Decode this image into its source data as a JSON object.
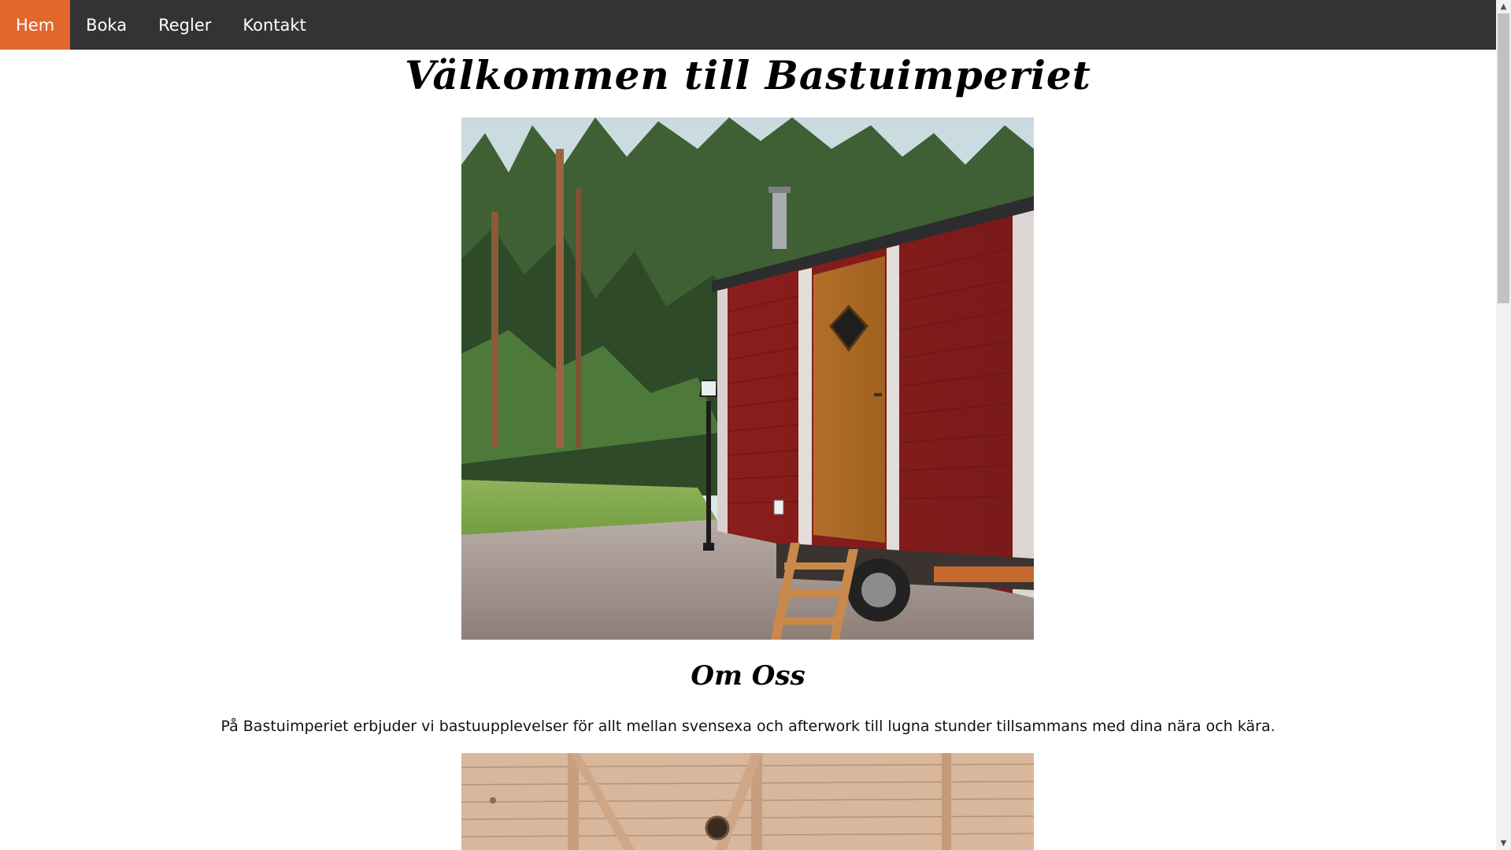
{
  "nav": {
    "items": [
      {
        "label": "Hem",
        "active": true
      },
      {
        "label": "Boka",
        "active": false
      },
      {
        "label": "Regler",
        "active": false
      },
      {
        "label": "Kontakt",
        "active": false
      }
    ]
  },
  "main": {
    "title": "Välkommen till Bastuimperiet",
    "about_heading": "Om Oss",
    "about_text": "På Bastuimperiet erbjuder vi bastuupplevelser för allt mellan svensexa och afterwork till lugna stunder tillsammans med dina nära och kära."
  },
  "colors": {
    "nav_bg": "#333333",
    "nav_active": "#e2672c",
    "nav_text": "#ffffff"
  },
  "icons": {
    "scroll_up": "▲",
    "scroll_down": "▼"
  }
}
